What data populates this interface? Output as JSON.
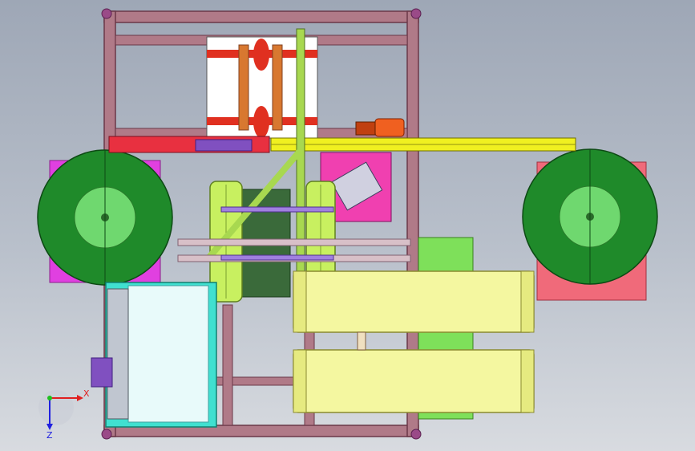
{
  "viewport": {
    "background_top": "#9ea7b6",
    "background_bottom": "#d8dbe0"
  },
  "colors": {
    "frame": "#b07a88",
    "frame_dark": "#7a4553",
    "roller_green": "#1f7a1f",
    "roller_light": "#7fe07f",
    "magenta_pad": "#e040e0",
    "pink_pad": "#f06a7a",
    "lime_bar": "#c8f060",
    "yellow_pad": "#f4f7a0",
    "bright_green": "#7ee05a",
    "yellow_rail": "#f0f020",
    "orange_motor": "#f06020",
    "cyan_panel": "#40e0d0",
    "purple_rail": "#a080e0"
  },
  "triad": {
    "x_label": "X",
    "y_label": "Y",
    "z_label": "Z"
  },
  "parts": {
    "frame": "welded-frame",
    "left_roller": "left-winding-drum",
    "right_roller": "right-winding-drum",
    "cutter_block": "upper-cutter-assembly",
    "motor": "drive-motor",
    "conveyor_upper": "upper-conveyor-belt",
    "conveyor_lower": "lower-conveyor-belt",
    "control_panel": "electrical-cabinet"
  }
}
